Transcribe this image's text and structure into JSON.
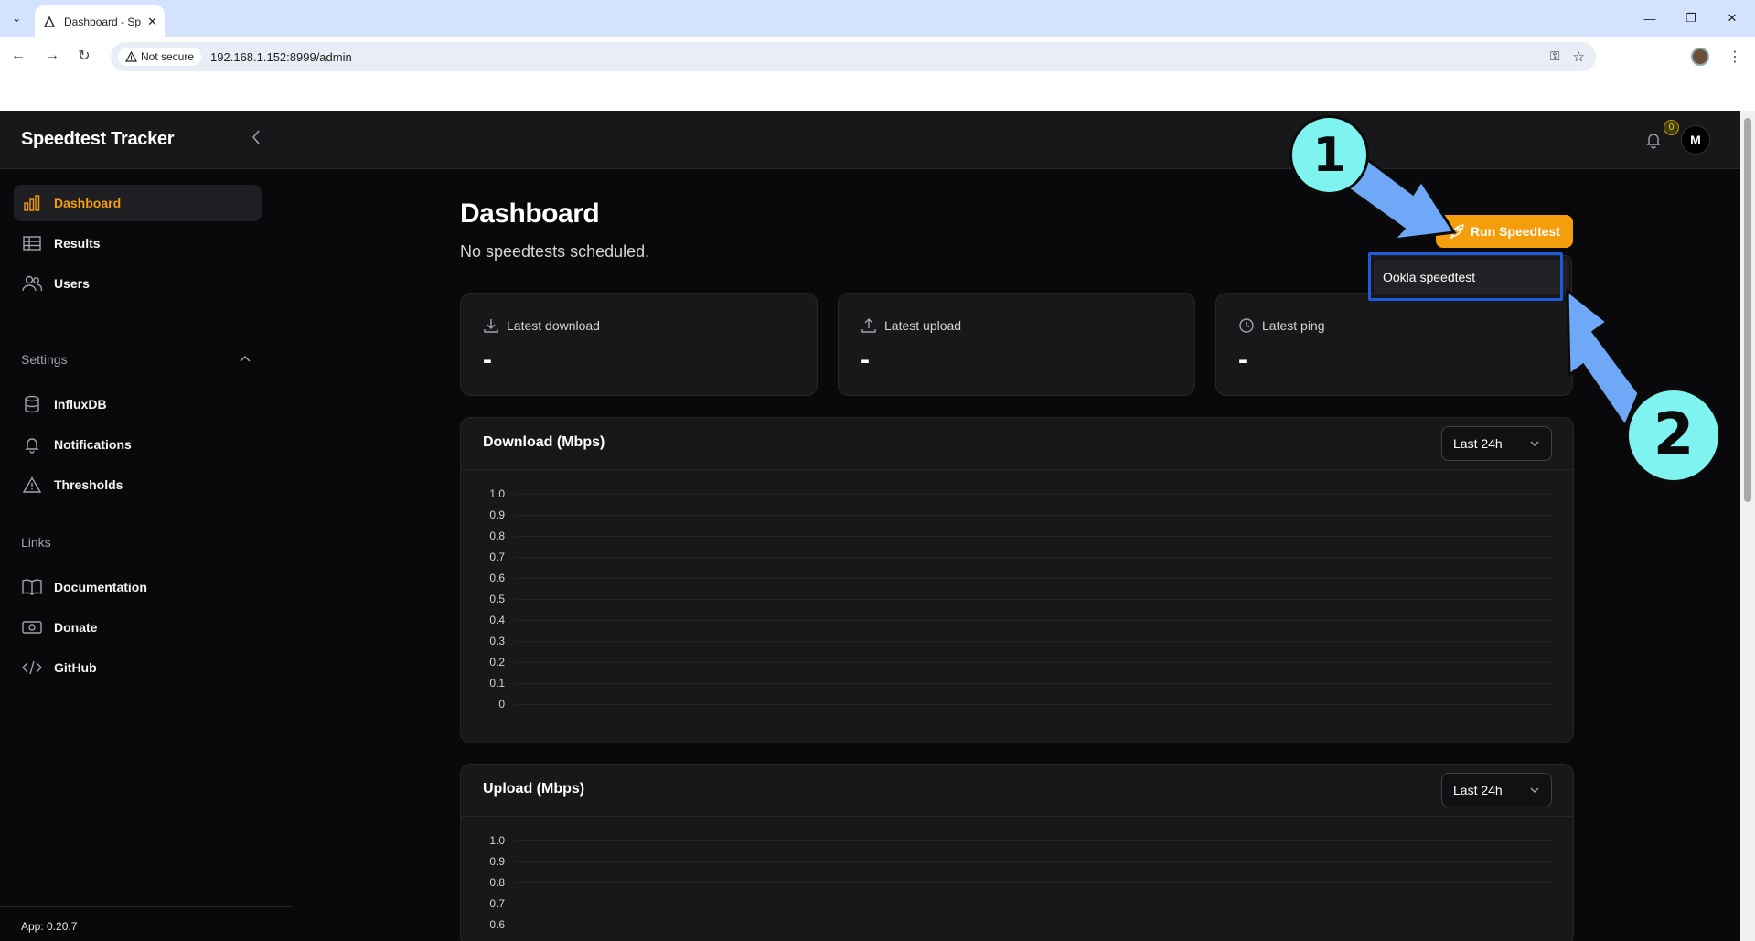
{
  "browser": {
    "tab_title": "Dashboard - Sp",
    "not_secure_label": "Not secure",
    "url": "192.168.1.152:8999/admin"
  },
  "app": {
    "brand": "Speedtest Tracker",
    "notification_count": "0",
    "avatar_initial": "M",
    "version": "App: 0.20.7"
  },
  "sidebar": {
    "items": [
      {
        "label": "Dashboard",
        "icon": "bar-chart-icon",
        "active": true
      },
      {
        "label": "Results",
        "icon": "table-icon"
      },
      {
        "label": "Users",
        "icon": "users-icon"
      }
    ],
    "settings_label": "Settings",
    "settings_items": [
      {
        "label": "InfluxDB",
        "icon": "database-icon"
      },
      {
        "label": "Notifications",
        "icon": "bell-icon"
      },
      {
        "label": "Thresholds",
        "icon": "warning-icon"
      }
    ],
    "links_label": "Links",
    "link_items": [
      {
        "label": "Documentation",
        "icon": "book-icon"
      },
      {
        "label": "Donate",
        "icon": "cash-icon"
      },
      {
        "label": "GitHub",
        "icon": "code-icon"
      }
    ]
  },
  "main": {
    "title": "Dashboard",
    "subtitle": "No speedtests scheduled.",
    "run_button": "Run Speedtest",
    "dropdown_item": "Ookla speedtest",
    "stats": [
      {
        "label": "Latest download",
        "value": "-",
        "icon": "download-icon"
      },
      {
        "label": "Latest upload",
        "value": "-",
        "icon": "upload-icon"
      },
      {
        "label": "Latest ping",
        "value": "-",
        "icon": "clock-icon"
      }
    ],
    "charts": [
      {
        "title": "Download (Mbps)",
        "range": "Last 24h"
      },
      {
        "title": "Upload (Mbps)",
        "range": "Last 24h"
      }
    ]
  },
  "chart_data": [
    {
      "type": "line",
      "title": "Download (Mbps)",
      "y_ticks": [
        "1.0",
        "0.9",
        "0.8",
        "0.7",
        "0.6",
        "0.5",
        "0.4",
        "0.3",
        "0.2",
        "0.1",
        "0"
      ],
      "ylim": [
        0,
        1
      ],
      "series": [],
      "grid": true
    },
    {
      "type": "line",
      "title": "Upload (Mbps)",
      "y_ticks": [
        "1.0",
        "0.9",
        "0.8",
        "0.7",
        "0.6"
      ],
      "ylim": [
        0,
        1
      ],
      "series": [],
      "grid": true
    }
  ],
  "annotations": {
    "callout_1": "1",
    "callout_2": "2",
    "arrow_color": "#6ea8f7",
    "callout_color": "#7ff3ef"
  }
}
